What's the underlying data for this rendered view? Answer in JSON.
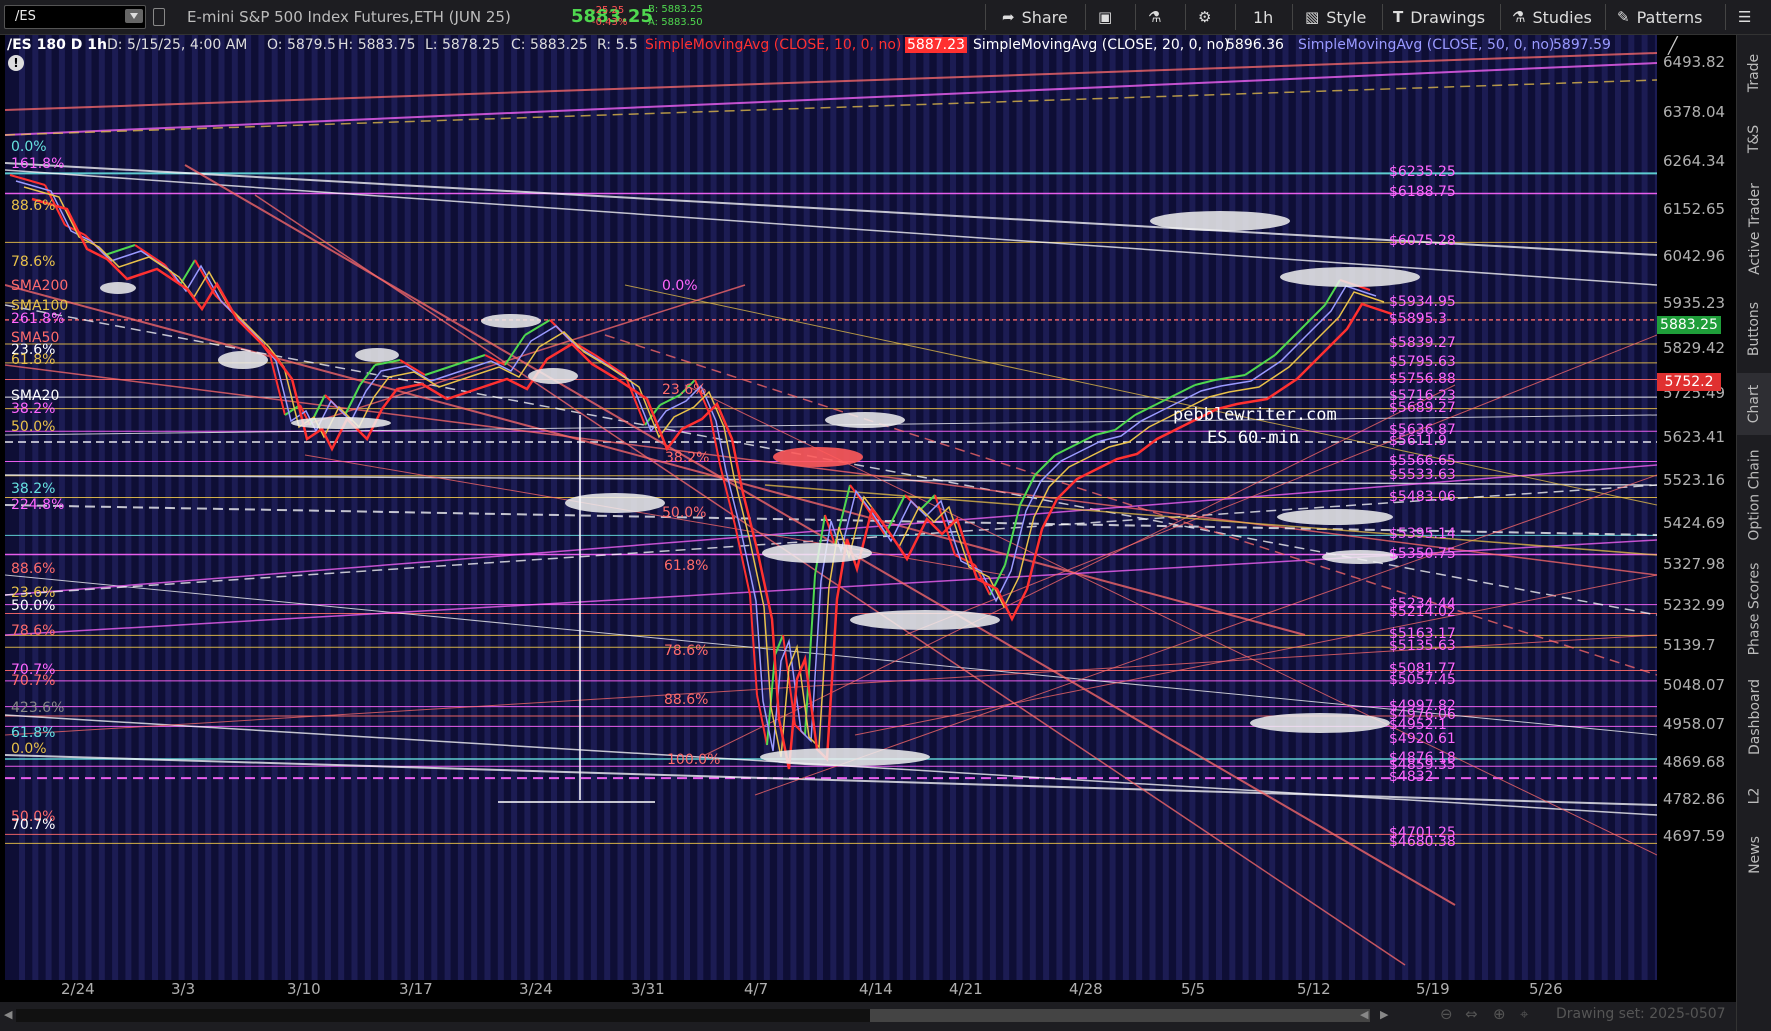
{
  "toolbar": {
    "symbol": "/ES",
    "description": "E-mini S&P 500 Index Futures,ETH (JUN 25)",
    "last_price": "5883.25",
    "net_change": "-25.25",
    "pct_change": "-0.43%",
    "bid": "B: 5883.25",
    "ask": "A: 5883.50",
    "share_label": "Share",
    "timeframe_label": "1h",
    "style_label": "Style",
    "drawings_label": "Drawings",
    "studies_label": "Studies",
    "patterns_label": "Patterns"
  },
  "info_bar": {
    "chart_id": "/ES 180 D 1h",
    "date": "D: 5/15/25, 4:00 AM",
    "open": "O: 5879.5",
    "high": "H: 5883.75",
    "low": "L: 5878.25",
    "close": "C: 5883.25",
    "range": "R: 5.5",
    "sma10_label": "SimpleMovingAvg (CLOSE, 10, 0, no)",
    "sma10_value": "5887.23",
    "sma20_label": "SimpleMovingAvg (CLOSE, 20, 0, no)",
    "sma20_value": "5896.36",
    "sma50_label": "SimpleMovingAvg (CLOSE, 50, 0, no)",
    "sma50_value": "5897.59"
  },
  "colors": {
    "background": "#0e0e35",
    "sma10": "#ff3030",
    "sma20": "#ffffff",
    "sma50": "#9a9aff",
    "up": "#4fd84f",
    "down": "#ff3030",
    "fib": "#e8c14a",
    "magenta": "#ff66ff",
    "salmon": "#ff6b6b",
    "cyan": "#66e0e0"
  },
  "y_axis": {
    "ticks": [
      "6493.82",
      "6378.04",
      "6264.34",
      "6152.65",
      "6042.96",
      "5935.23",
      "5829.42",
      "5725.49",
      "5623.41",
      "5523.16",
      "5424.69",
      "5327.98",
      "5232.99",
      "5139.7",
      "5048.07",
      "4958.07",
      "4869.68",
      "4782.86",
      "4697.59"
    ],
    "current_price_badge": "5883.25",
    "sma_badge": "5752.2"
  },
  "x_axis": {
    "ticks": [
      "2/24",
      "3/3",
      "3/10",
      "3/17",
      "3/24",
      "3/31",
      "4/7",
      "4/14",
      "4/21",
      "4/28",
      "5/5",
      "5/12",
      "5/19",
      "5/26"
    ]
  },
  "left_labels": [
    "0.0%",
    "161.8%",
    "88.6%",
    "78.6%",
    "SMA200",
    "SMA100",
    "261.8%",
    "SMA50",
    "23.6%",
    "61.8%",
    "SMA20",
    "38.2%",
    "50.0%",
    "38.2%",
    "224.8%",
    "88.6%",
    "23.6%",
    "50.0%",
    "78.6%",
    "70.7%",
    "70.7%",
    "423.6%",
    "61.8%",
    "0.0%",
    "50.0%",
    "70.7%"
  ],
  "mid_labels": [
    "0.0%",
    "23.6%",
    "38.2%",
    "50.0%",
    "61.8%",
    "78.6%",
    "88.6%",
    "100.0%"
  ],
  "right_labels": [
    "$6235.25",
    "$6188.75",
    "$6075.28",
    "$5934.95",
    "$5895.3",
    "$5839.27",
    "$5795.63",
    "$5756.88",
    "$5716.23",
    "$5689.27",
    "$5636.87",
    "$5611.9",
    "$5566.65",
    "$5533.63",
    "$5483.06",
    "$5395.14",
    "$5350.75",
    "$5234.44",
    "$5214.02",
    "$5163.17",
    "$5135.63",
    "$5081.77",
    "$5057.45",
    "$4997.82",
    "$4976.06",
    "$4952.1",
    "$4920.61",
    "$4876.18",
    "$4859.35",
    "$4832",
    "$4701.25",
    "$4680.38"
  ],
  "watermark": {
    "line1": "pebblewriter.com",
    "line2": "ES 60-min"
  },
  "side_tabs": [
    "Trade",
    "T&S",
    "Active Trader",
    "Buttons",
    "Chart",
    "Option Chain",
    "Phase Scores",
    "Dashboard",
    "L2",
    "News"
  ],
  "status": {
    "drawing_set": "Drawing set: 2025-0507"
  }
}
